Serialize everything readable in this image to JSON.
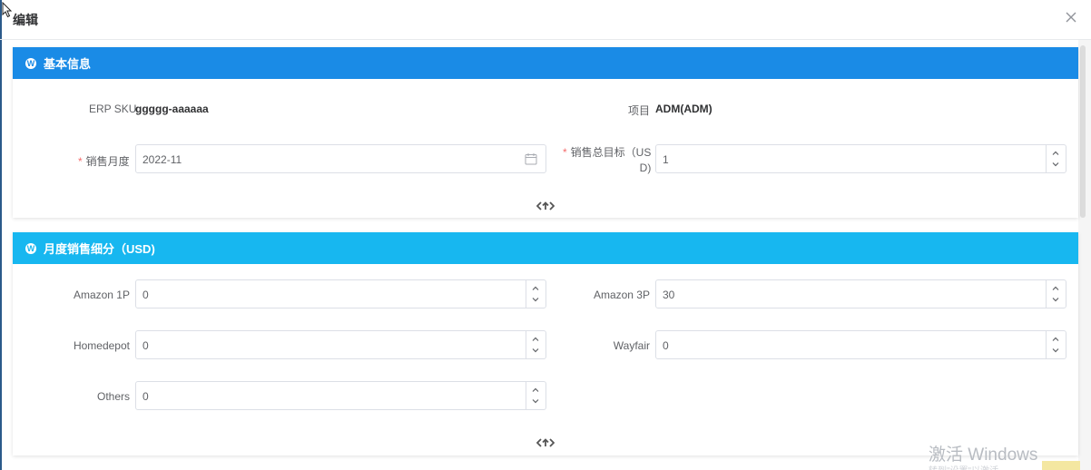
{
  "dialog": {
    "title": "编辑"
  },
  "basic": {
    "header": "基本信息",
    "erp_sku_label": "ERP SKU",
    "erp_sku_value": "ggggg-aaaaaa",
    "project_label": "项目",
    "project_value": "ADM(ADM)",
    "month_label": "销售月度",
    "month_value": "2022-11",
    "target_label_line1": "销售总目标（US",
    "target_label_line2": "D)",
    "target_value": "1"
  },
  "monthly": {
    "header": "月度销售细分（USD)",
    "amazon1p_label": "Amazon 1P",
    "amazon1p_value": "0",
    "amazon3p_label": "Amazon 3P",
    "amazon3p_value": "30",
    "homedepot_label": "Homedepot",
    "homedepot_value": "0",
    "wayfair_label": "Wayfair",
    "wayfair_value": "0",
    "others_label": "Others",
    "others_value": "0"
  },
  "watermark": {
    "text": "激活 Windows",
    "sub": "转到\"设置\"以激活"
  },
  "colors": {
    "primary_header": "#1a8be6",
    "secondary_header": "#17b7f0",
    "required": "#f56c6c"
  },
  "icons": {
    "close": "close-icon",
    "calendar": "calendar-icon",
    "collapse": "collapse-icon",
    "panel": "wp-icon"
  }
}
